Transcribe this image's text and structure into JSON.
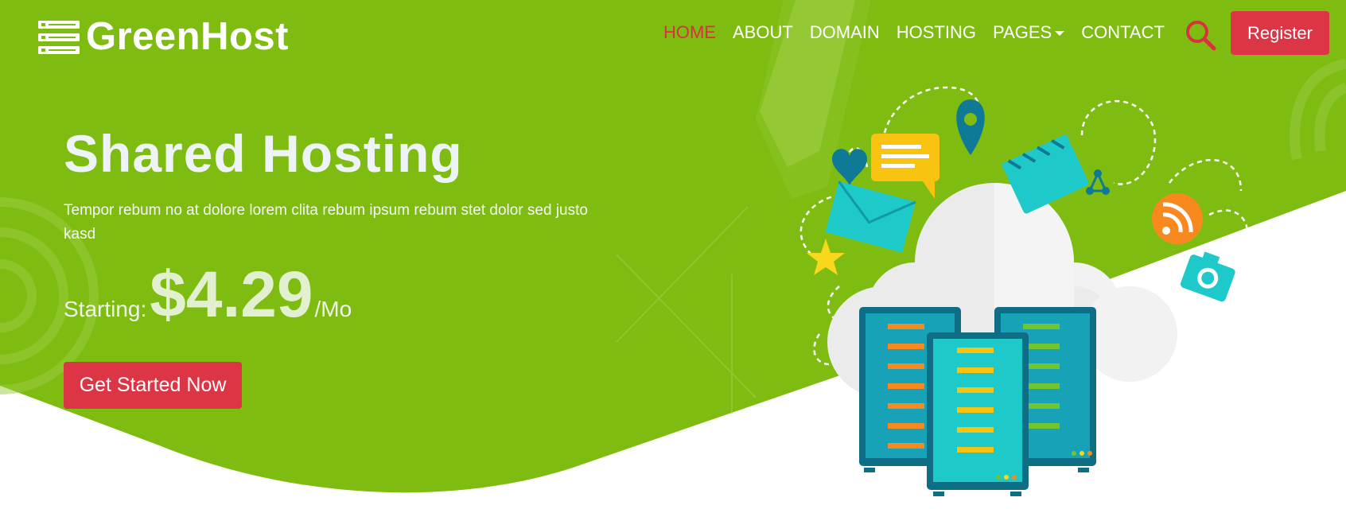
{
  "brand": {
    "name": "GreenHost",
    "icon": "server-stack-icon"
  },
  "nav": {
    "items": [
      {
        "label": "HOME",
        "active": true
      },
      {
        "label": "ABOUT",
        "active": false
      },
      {
        "label": "DOMAIN",
        "active": false
      },
      {
        "label": "HOSTING",
        "active": false
      },
      {
        "label": "PAGES",
        "active": false,
        "dropdown": true
      },
      {
        "label": "CONTACT",
        "active": false
      }
    ],
    "search_icon": "search-icon",
    "register_label": "Register"
  },
  "hero": {
    "title": "Shared Hosting",
    "description": "Tempor rebum no at dolore lorem clita rebum ipsum rebum stet dolor sed justo kasd",
    "price_prefix": "Starting:",
    "price_amount": "$4.29",
    "price_suffix": "/Mo",
    "cta_label": "Get Started Now"
  },
  "colors": {
    "hero_green": "#7fbc12",
    "accent_red": "#dc3545",
    "active_nav": "#d8323c",
    "white": "#ffffff"
  }
}
